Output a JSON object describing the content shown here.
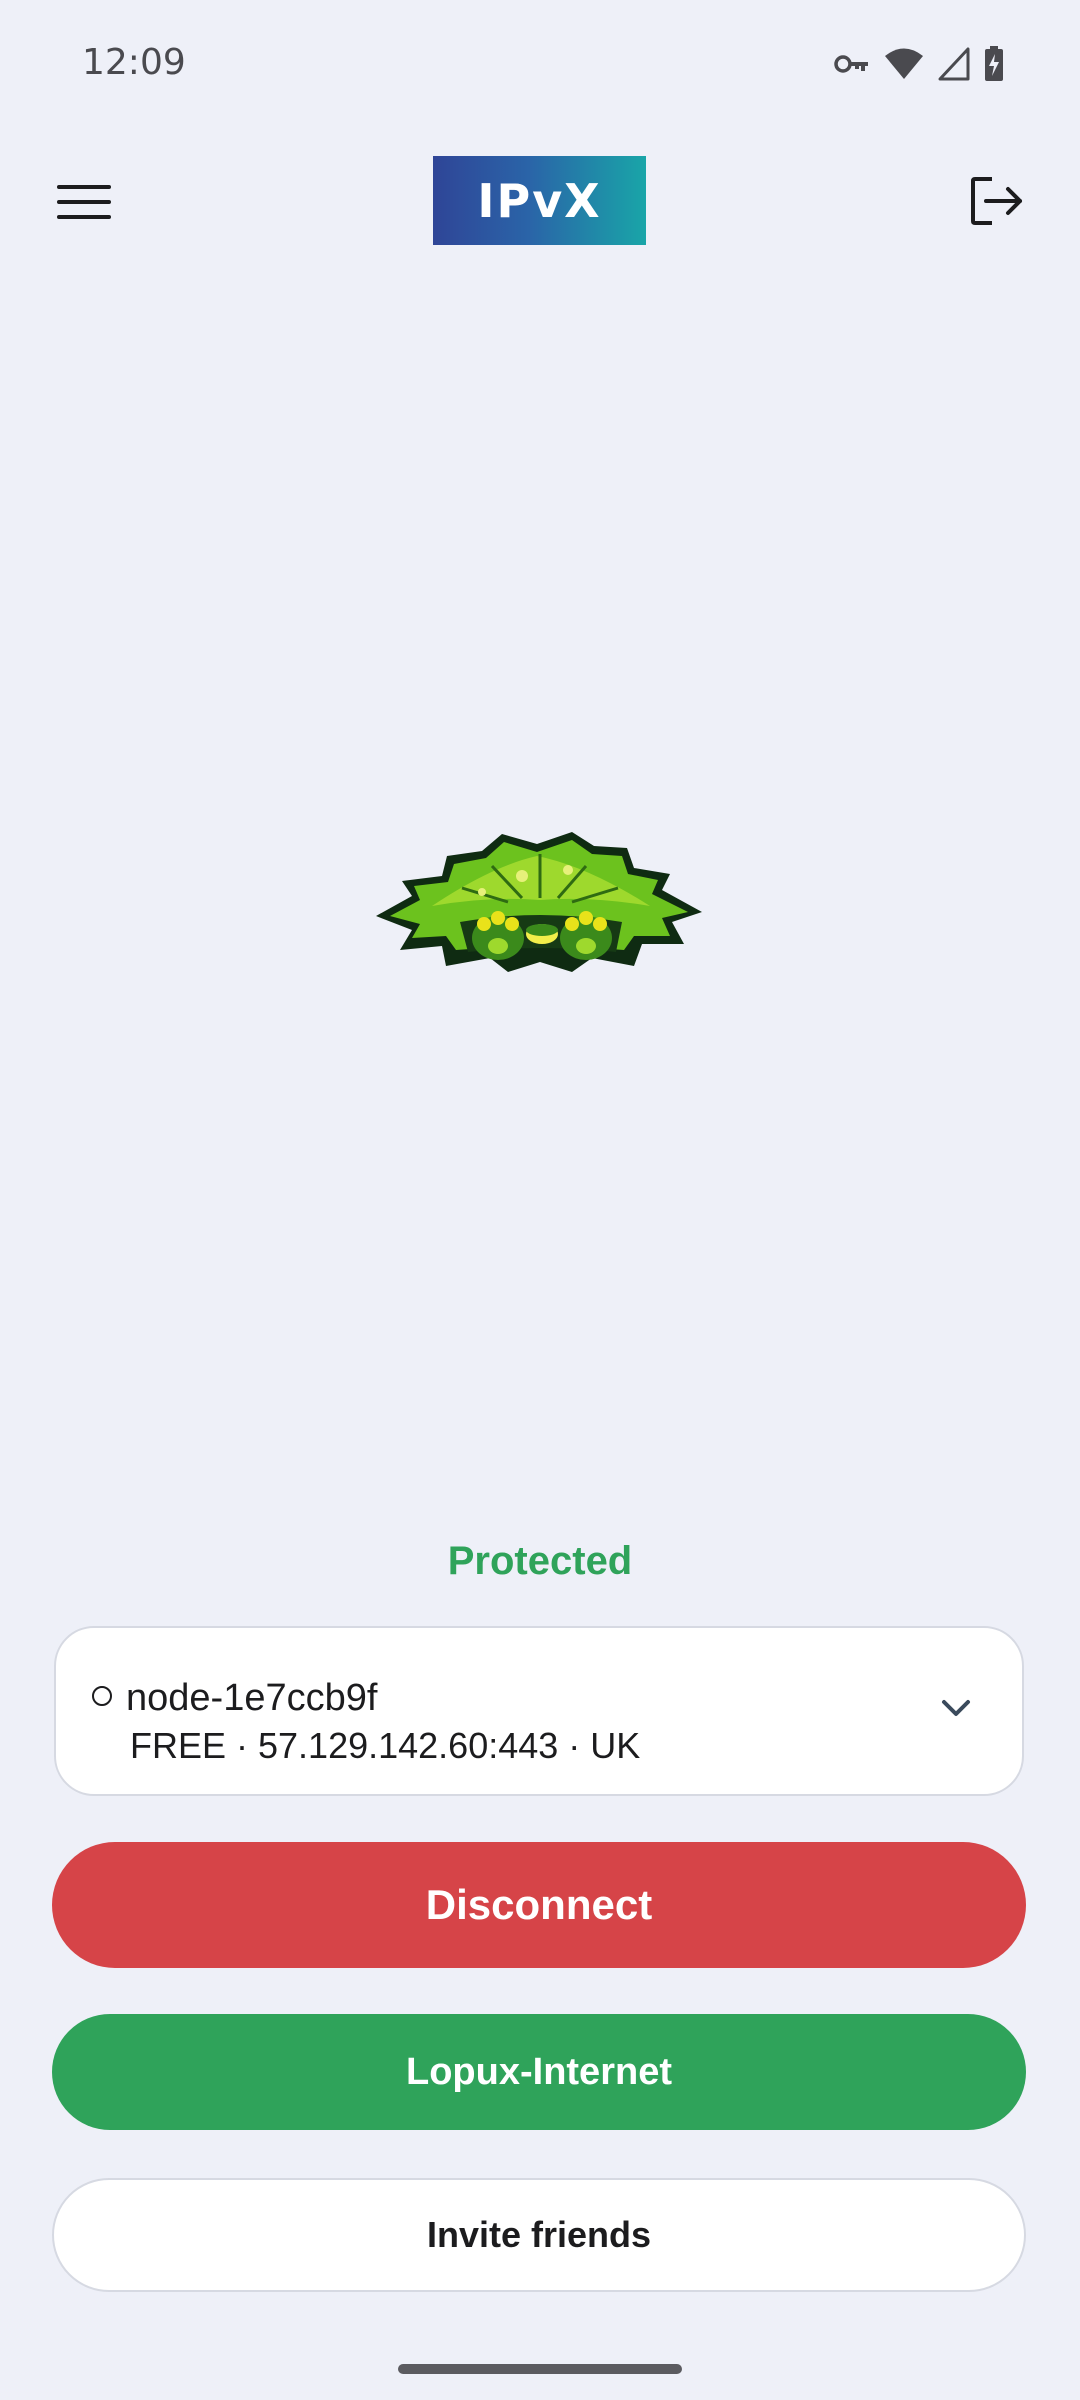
{
  "status_bar": {
    "time": "12:09",
    "icons": [
      "vpn-key-icon",
      "wifi-icon",
      "cellular-signal-icon",
      "battery-charging-icon"
    ]
  },
  "app_bar": {
    "logo_text": "IPvX",
    "menu_icon": "hamburger-menu-icon",
    "logout_icon": "logout-icon"
  },
  "connection": {
    "status": "Protected",
    "status_color": "#2fa35a"
  },
  "server": {
    "status_icon": "○",
    "name": "node-1e7ccb9f",
    "details": "FREE · 57.129.142.60:443 · UK",
    "dropdown_icon": "chevron-down-icon"
  },
  "buttons": {
    "disconnect": "Disconnect",
    "lopux": "Lopux-Internet",
    "invite": "Invite friends"
  },
  "colors": {
    "background": "#eef0f8",
    "disconnect": "#d64448",
    "lopux": "#2fa35a",
    "logo_gradient_start": "#2f4597",
    "logo_gradient_end": "#19a5a8"
  }
}
